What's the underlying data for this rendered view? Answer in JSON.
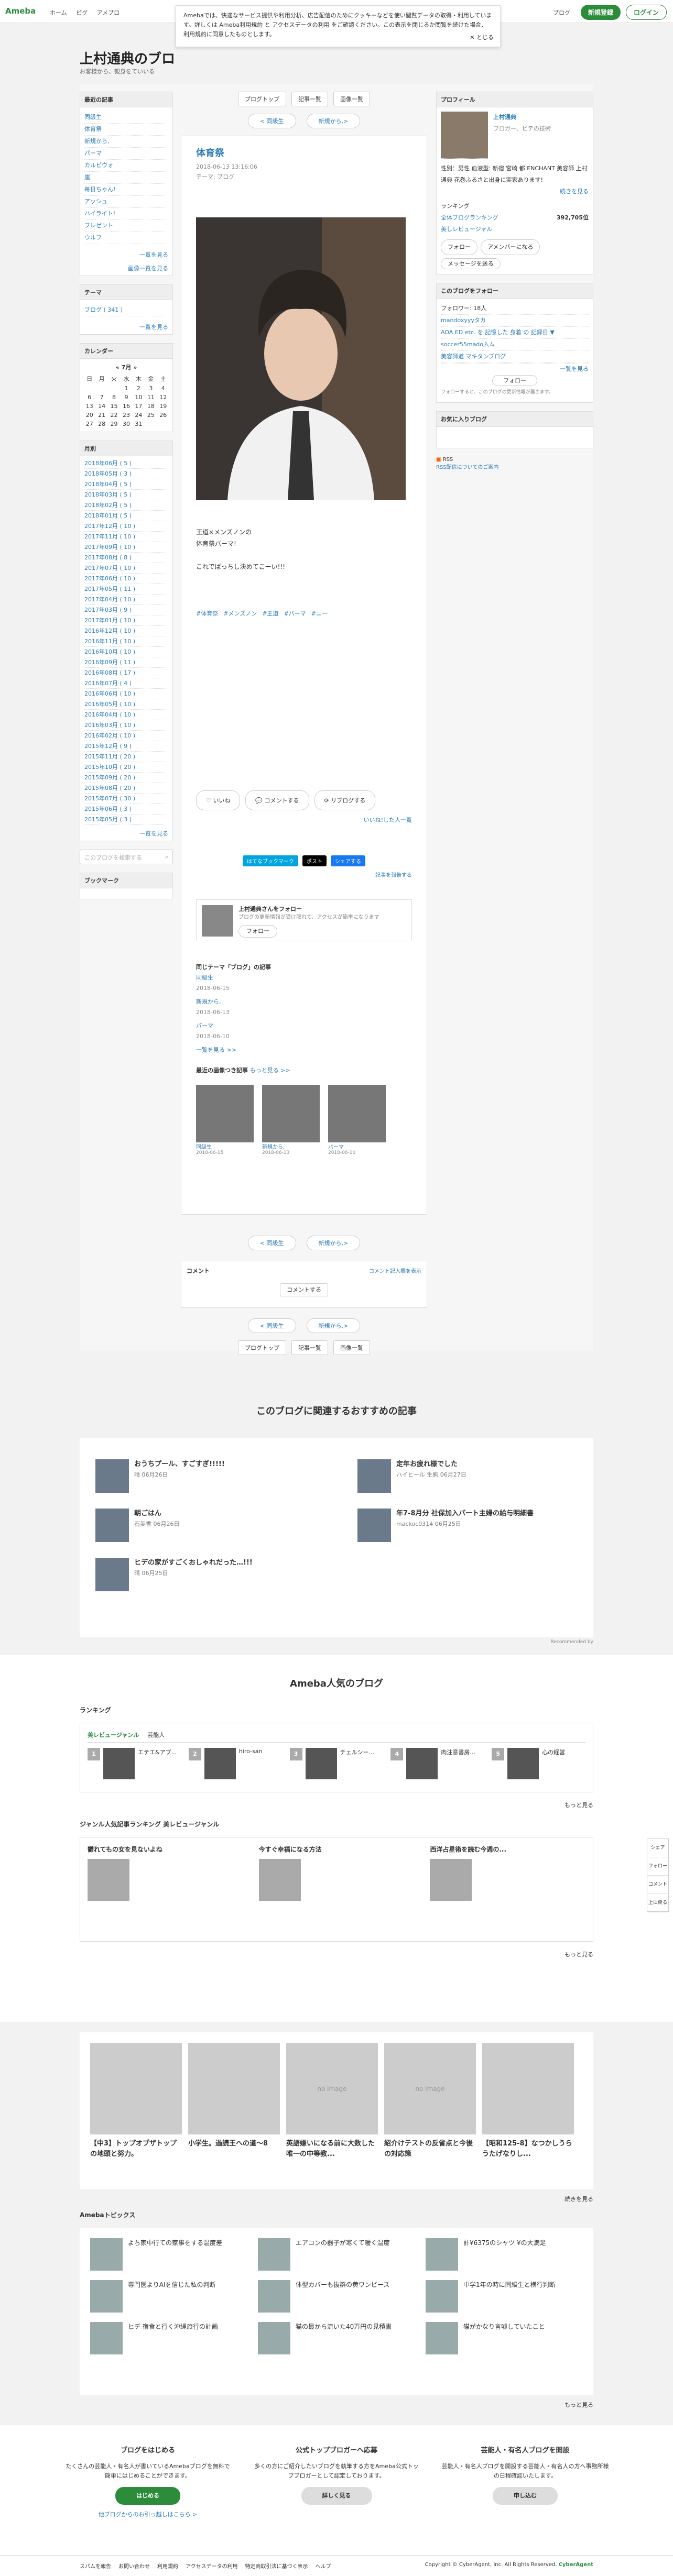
{
  "header": {
    "logo": "Ameba",
    "nav": [
      "ホーム",
      "ピグ",
      "アメブロ"
    ],
    "blog_link": "ブログ",
    "signup": "新規登録",
    "login": "ログイン"
  },
  "notice": {
    "text": "Amebaでは、快適なサービス提供や利用分析、広告配信のためにクッキーなどを使い閲覧データの取得・利用しています。詳しくは Ameba利用規約 と アクセスデータの利用 をご確認ください。この表示を閉じるか閲覧を続けた場合、利用規約に同意したものとします。",
    "close": "とじる"
  },
  "blog": {
    "title": "上村通典のブロ",
    "desc": "お客様から、親身をていいる"
  },
  "left": {
    "recent_h": "最近の記事",
    "recent": [
      "同級生",
      "体育祭",
      "新規から,",
      "パーマ",
      "カルピウォ",
      "嵐",
      "毎日ちゃん!",
      "アッシュ",
      "ハイライト!",
      "プレゼント",
      "ウルフ"
    ],
    "recent_more": "一覧を見る",
    "img_more": "画像一覧を見る",
    "theme_h": "テーマ",
    "theme": [
      "ブログ ( 341 )"
    ],
    "theme_more": "一覧を見る",
    "cal_h": "カレンダー",
    "cal_month": "7月",
    "cal_days": [
      "日",
      "月",
      "火",
      "水",
      "木",
      "金",
      "土"
    ],
    "cal_rows": [
      [
        "",
        "",
        "",
        "1",
        "2",
        "3",
        "4",
        "5"
      ],
      [
        "6",
        "7",
        "8",
        "9",
        "10",
        "11",
        "12"
      ],
      [
        "13",
        "14",
        "15",
        "16",
        "17",
        "18",
        "19"
      ],
      [
        "20",
        "21",
        "22",
        "23",
        "24",
        "25",
        "26"
      ],
      [
        "27",
        "28",
        "29",
        "30",
        "31",
        "",
        ""
      ]
    ],
    "month_h": "月別",
    "months": [
      "2018年06月 ( 5 )",
      "2018年05月 ( 3 )",
      "2018年04月 ( 5 )",
      "2018年03月 ( 5 )",
      "2018年02月 ( 5 )",
      "2018年01月 ( 5 )",
      "2017年12月 ( 10 )",
      "2017年11月 ( 10 )",
      "2017年09月 ( 10 )",
      "2017年08月 ( 8 )",
      "2017年07月 ( 10 )",
      "2017年06月 ( 10 )",
      "2017年05月 ( 11 )",
      "2017年04月 ( 10 )",
      "2017年03月 ( 9 )",
      "2017年01月 ( 10 )",
      "2016年12月 ( 10 )",
      "2016年11月 ( 10 )",
      "2016年10月 ( 10 )",
      "2016年09月 ( 11 )",
      "2016年08月 ( 17 )",
      "2016年07月 ( 4 )",
      "2016年06月 ( 10 )",
      "2016年05月 ( 10 )",
      "2016年04月 ( 10 )",
      "2016年03月 ( 10 )",
      "2016年02月 ( 10 )",
      "2015年12月 ( 9 )",
      "2015年11月 ( 20 )",
      "2015年10月 ( 20 )",
      "2015年09月 ( 20 )",
      "2015年08月 ( 20 )",
      "2015年07月 ( 30 )",
      "2015年06月 ( 3 )",
      "2015年05月 ( 3 )"
    ],
    "month_more": "一覧を見る",
    "search_ph": "このブログを検索する",
    "bookmark_h": "ブックマーク"
  },
  "main": {
    "topbar": [
      "ブログトップ",
      "記事一覧",
      "画像一覧"
    ],
    "prev": "< 同級生",
    "next": "新規から,>",
    "title": "体育祭",
    "date": "2018-06-13 13:16:06",
    "theme": "テーマ: ブログ",
    "text": [
      "王道×メンズノンの",
      "体育祭パーマ!",
      "",
      "これでばっちし決めてこーい!!!"
    ],
    "tags": [
      "#体育祭",
      "#メンズノン",
      "#王道",
      "#パーマ",
      "#ニ一"
    ],
    "like": "いいね",
    "comment": "コメントする",
    "reblog": "リブログする",
    "like_list": "いいね!した人一覧",
    "share": [
      "はてなブックマーク",
      "ポスト",
      "シェアする"
    ],
    "share_link": "記事を報告する",
    "follow_text": "上村通典さんをフォロー",
    "follow_sub": "ブログの更新情報が受け取れて、アクセスが簡単になります",
    "follow_btn": "フォロー",
    "same_h": "同じテーマ「ブログ」の記事",
    "same": [
      {
        "t": "同級生",
        "d": "2018-06-15"
      },
      {
        "t": "新規から,",
        "d": "2018-06-13"
      },
      {
        "t": "パーマ",
        "d": "2018-06-10"
      }
    ],
    "same_more": "一覧を見る >>",
    "img_h": "最近の画像つき記事",
    "img_more": "もっと見る >>",
    "thumbs": [
      {
        "t": "同級生",
        "d": "2018-06-15"
      },
      {
        "t": "新規から,",
        "d": "2018-06-13"
      },
      {
        "t": "パーマ",
        "d": "2018-06-10"
      }
    ],
    "comment_h": "コメント",
    "comment_disp": "コメント記入欄を表示",
    "comment_btn": "コメントする"
  },
  "right": {
    "profile_h": "プロフィール",
    "name": "上村通典",
    "sub": "ブロガー、ビテの技術",
    "info": "性別：男性  血液型: 新宿 宮崎 都 ENCHANT 美容師 上村通典 花巻ふるさと出身に実家あります!",
    "more": "続きを見る",
    "rank_h": "ランキング",
    "rank_l": "全体ブログランキング",
    "rank_v": "392,705位",
    "rank_sub": "美しレビュージャル",
    "follow": "フォロー",
    "fan": "アメンバーになる",
    "msg": "メッセージを送る",
    "fw_h": "このブログをフォロー",
    "fw_count": "フォロワー: 18人",
    "fw_list": [
      "mandoxyyyタカ",
      "AOA ED etc. を 記憶した 身着 の 記録日 ▼",
      "soccer55mado入ム",
      "美容師道 マキタンブログ"
    ],
    "fw_more": "一覧を見る",
    "fw_btn": "フォロー",
    "fw_sub": "フォローすると、このブログの更新情報が届きます。",
    "fav_h": "お気に入りブログ",
    "rss": "RSS",
    "rss_sub": "RSS配信についてのご案内"
  },
  "rec": {
    "h": "このブログに関連するおすすめの記事",
    "items": [
      {
        "t": "おうちプール、すごすぎ!!!!!",
        "s": "晴 06月26日"
      },
      {
        "t": "定年お疲れ様でした",
        "s": "ハイヒール 生駒 06月27日"
      },
      {
        "t": "朝ごはん",
        "s": "石美香 06月26日"
      },
      {
        "t": "年7-8月分 社保加入パート主婦の給与明細書",
        "s": "mackoc0314 06月25日"
      },
      {
        "t": "ヒデの家がすごくおしゃれだった…!!!",
        "s": "晴 06月25日"
      }
    ],
    "by": "Recommended by"
  },
  "pop": {
    "h": "Ameba人気のブログ",
    "rank_h": "ランキング",
    "tabs": [
      "美レビュージャンル",
      "芸能人"
    ],
    "rank": [
      "エテエ&アプ...",
      "hiro-san",
      "チェルシー...",
      "肉注意書房...",
      "心の経営"
    ],
    "more": "もっと見る",
    "genre_h": "ジャンル人気記事ランキング 美レビュージャンル",
    "genre": [
      "鬱れてもの女を見ないよね",
      "今すぐ幸福になる方法",
      "西洋占星術を読む今週の..."
    ]
  },
  "tiles": {
    "items": [
      "【中3】トップオブザトップの地頭と努力。",
      "小学生。過読王への道〜8",
      "英語嫌いになる前に大数した唯一の中等教...",
      "紹介けテストの反省点と今後の対応策",
      "【昭和125-8】なつかしうらうたげなりし..."
    ],
    "no_image": "no image",
    "more": "続きを見る"
  },
  "topics": {
    "h": "Amebaトピックス",
    "items": [
      "よち家中行ての家事をする温度差",
      "エアコンの器子が寒くて暖く温度",
      "計¥6375のシャツ ¥の大満足",
      "専門医よりAIを信じた私の判断",
      "体型カバーも抜群の黄ワンピース",
      "中学1年の時に同級生と横行判断",
      "ヒデ 宿食と行く沖縄旅行の計画",
      "猫の最から流いた40万円の見積書",
      "猫がかなり言嘘していたこと"
    ],
    "more": "もっと見る"
  },
  "foot": [
    {
      "h": "ブログをはじめる",
      "t": "たくさんの芸能人・有名人が書いているAmebaブログを無料で簡単にはじめることができます。",
      "b": "はじめる",
      "l": "他ブログからのお引っ越しはこちら >"
    },
    {
      "h": "公式トップブロガーへ応募",
      "t": "多くの方にご紹介したいブログを執筆する方をAmeba公式トップブロガーとして認定しております。",
      "b": "詳しく見る"
    },
    {
      "h": "芸能人・有名人ブログを開設",
      "t": "芸能人・有名人ブログを開設する芸能人・有名人の方へ事務所様の日程確認いたします。",
      "b": "申し込む"
    }
  ],
  "footer": {
    "links": [
      "スパムを報告",
      "お問い合わせ",
      "利用規約",
      "アクセスデータの利用",
      "特定商取引法に基づく表示",
      "ヘルプ"
    ],
    "copy": "Copyright © CyberAgent, Inc. All Rights Reserved.",
    "brand": "CyberAgent"
  },
  "floats": [
    "シェア",
    "フォロー",
    "コメント",
    "上に戻る"
  ]
}
